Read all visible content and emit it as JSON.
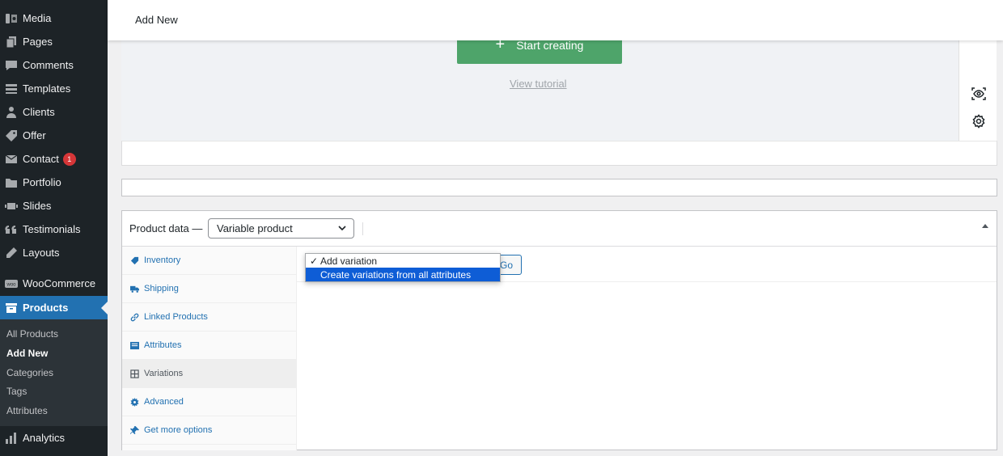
{
  "sidebar": {
    "items": [
      {
        "label": "Media",
        "icon": "media-icon"
      },
      {
        "label": "Pages",
        "icon": "pages-icon"
      },
      {
        "label": "Comments",
        "icon": "comments-icon"
      },
      {
        "label": "Templates",
        "icon": "templates-icon"
      },
      {
        "label": "Clients",
        "icon": "clients-icon"
      },
      {
        "label": "Offer",
        "icon": "offer-icon"
      },
      {
        "label": "Contact",
        "icon": "contact-icon",
        "badge": "1"
      },
      {
        "label": "Portfolio",
        "icon": "portfolio-icon"
      },
      {
        "label": "Slides",
        "icon": "slides-icon"
      },
      {
        "label": "Testimonials",
        "icon": "testimonials-icon"
      },
      {
        "label": "Layouts",
        "icon": "layouts-icon"
      },
      {
        "label": "WooCommerce",
        "icon": "woocommerce-icon"
      },
      {
        "label": "Products",
        "icon": "products-icon",
        "active": true
      }
    ],
    "submenu": [
      {
        "label": "All Products"
      },
      {
        "label": "Add New",
        "current": true
      },
      {
        "label": "Categories"
      },
      {
        "label": "Tags"
      },
      {
        "label": "Attributes"
      }
    ],
    "bottom_item": {
      "label": "Analytics",
      "icon": "analytics-icon"
    }
  },
  "header": {
    "title": "Add New"
  },
  "editor": {
    "start_button": "Start creating",
    "start_button_icon": "plus-icon",
    "view_tutorial": "View tutorial",
    "tools": [
      "preview-eye-icon",
      "gear-icon"
    ]
  },
  "product_data": {
    "label": "Product data —",
    "type_selected": "Variable product",
    "tabs": [
      {
        "label": "Inventory",
        "icon": "tag-icon"
      },
      {
        "label": "Shipping",
        "icon": "truck-icon"
      },
      {
        "label": "Linked Products",
        "icon": "link-icon"
      },
      {
        "label": "Attributes",
        "icon": "list-icon"
      },
      {
        "label": "Variations",
        "icon": "grid-icon",
        "active": true
      },
      {
        "label": "Advanced",
        "icon": "gear-icon"
      },
      {
        "label": "Get more options",
        "icon": "plugin-icon"
      }
    ],
    "go_button": "Go",
    "dropdown": {
      "options": [
        "Add variation",
        "Create variations from all attributes"
      ],
      "selected_index": 0,
      "highlighted_index": 1
    }
  },
  "colors": {
    "sidebar_bg": "#1d2327",
    "active_blue": "#2271b1",
    "start_green": "#4ea46a",
    "badge_red": "#d63638",
    "highlight": "#0e5dd6"
  }
}
